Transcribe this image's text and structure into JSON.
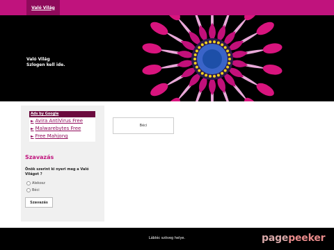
{
  "nav": {
    "tab": "Való Világ"
  },
  "header": {
    "site_title": "Való Világ",
    "slogan": "Szlogen kell ide."
  },
  "ads": {
    "heading": "Ads by Google",
    "links": [
      "Avira AntiVirus Free",
      "Malwarebytes Free",
      "Free Mahjong"
    ]
  },
  "poll": {
    "title": "Szavazás",
    "question": "Önök szerint ki nyeri meg a Való Világot ?",
    "options": [
      "Alekosz",
      "Béci"
    ],
    "button": "Szavazás"
  },
  "content": {
    "box_text": "Béci"
  },
  "footer": {
    "text": "Lábléc szöveg helye."
  },
  "watermark": {
    "part1": "page",
    "part2": "peeker"
  },
  "colors": {
    "brand": "#c0137d",
    "nav_active": "#8f0a5b",
    "ads_header": "#6b0a3e"
  }
}
